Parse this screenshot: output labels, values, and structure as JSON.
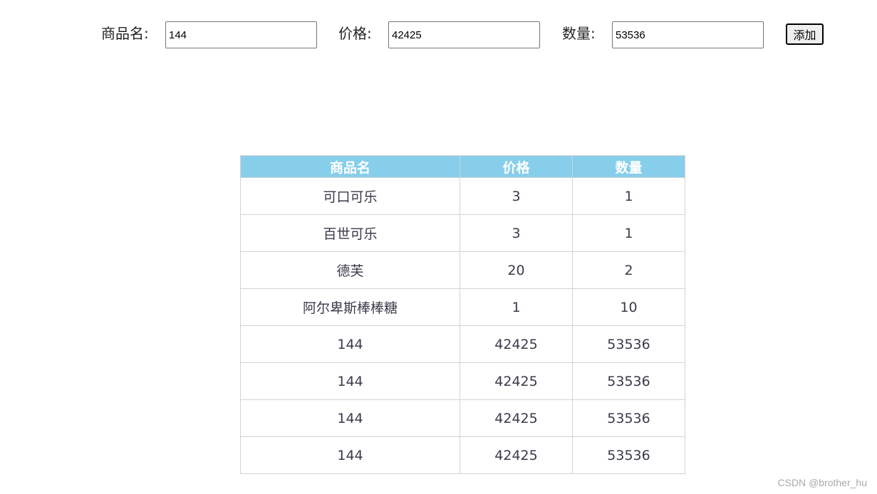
{
  "form": {
    "name_label": "商品名:",
    "name_value": "144",
    "price_label": "价格:",
    "price_value": "42425",
    "qty_label": "数量:",
    "qty_value": "53536",
    "add_button": "添加"
  },
  "table": {
    "headers": [
      "商品名",
      "价格",
      "数量"
    ],
    "rows": [
      [
        "可口可乐",
        "3",
        "1"
      ],
      [
        "百世可乐",
        "3",
        "1"
      ],
      [
        "德芙",
        "20",
        "2"
      ],
      [
        "阿尔卑斯棒棒糖",
        "1",
        "10"
      ],
      [
        "144",
        "42425",
        "53536"
      ],
      [
        "144",
        "42425",
        "53536"
      ],
      [
        "144",
        "42425",
        "53536"
      ],
      [
        "144",
        "42425",
        "53536"
      ]
    ]
  },
  "watermark": "CSDN @brother_hu",
  "colors": {
    "header_bg": "#87ceeb",
    "header_text": "#ffffff",
    "border": "#d3d3d3"
  }
}
